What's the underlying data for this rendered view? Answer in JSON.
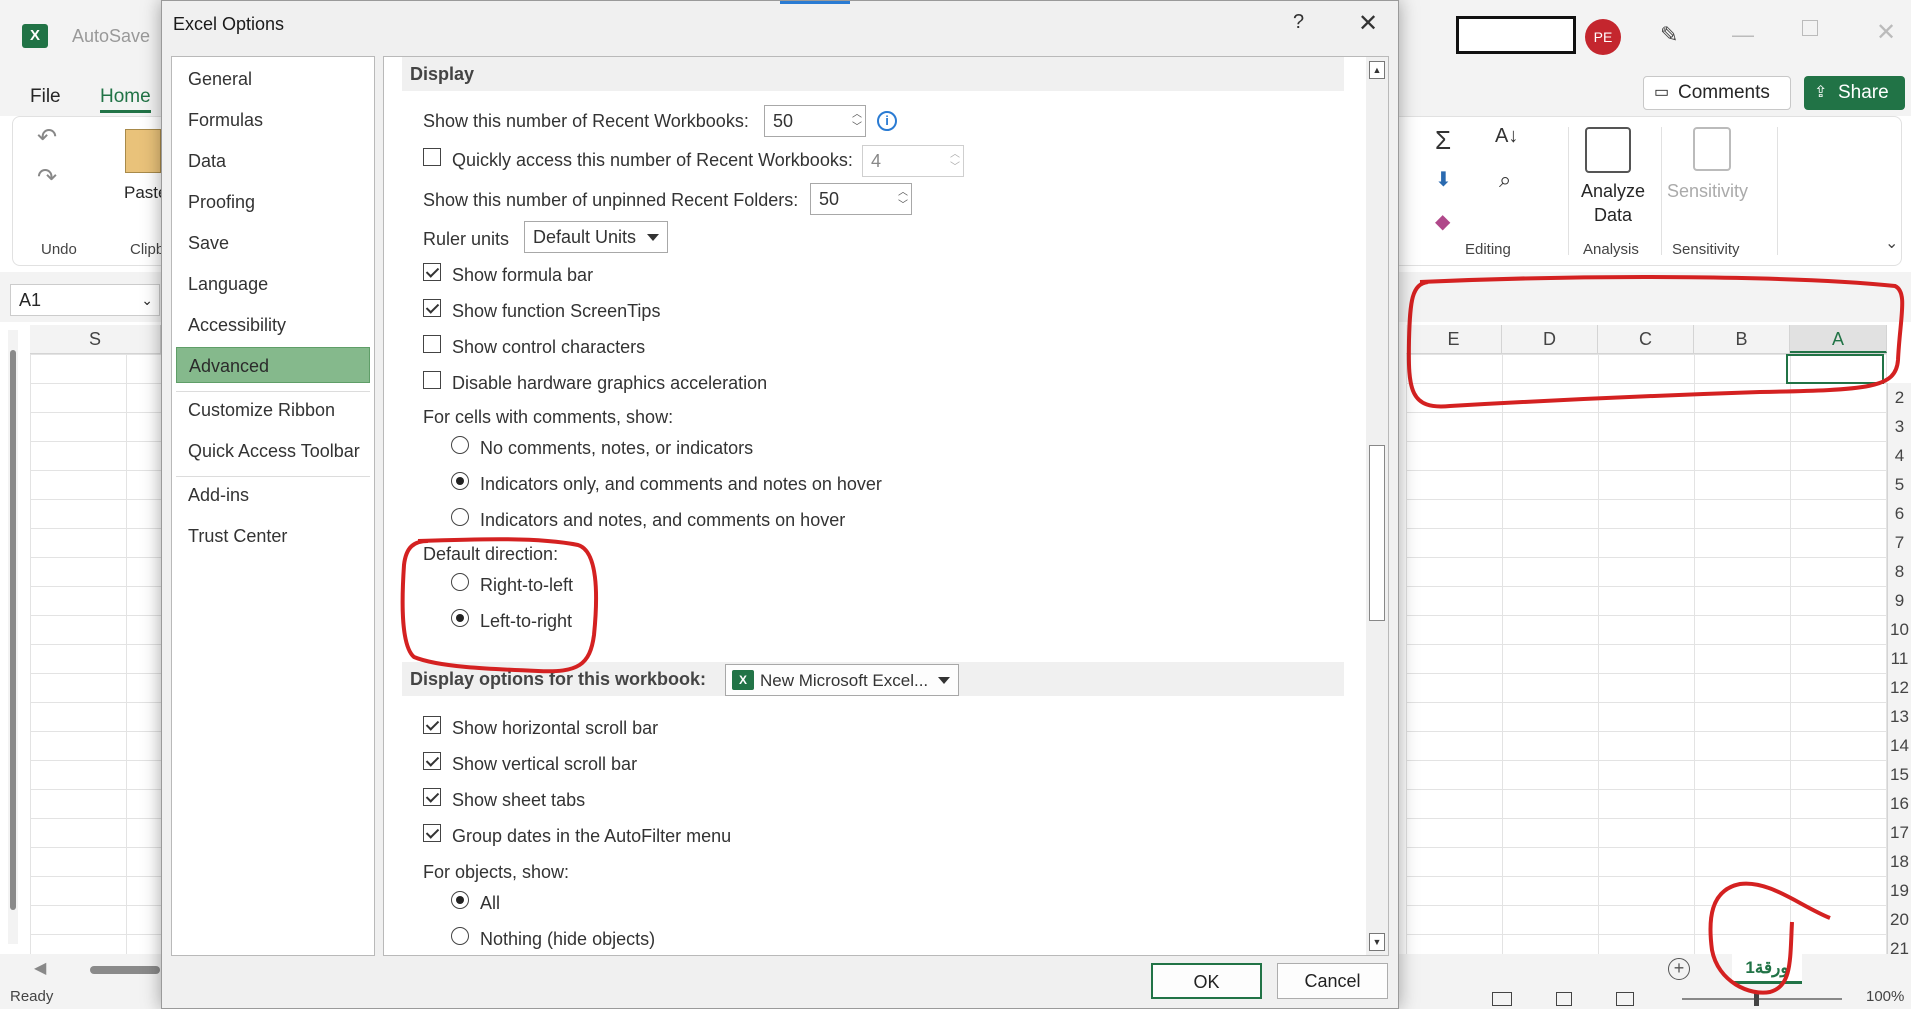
{
  "excel": {
    "autosave_label": "AutoSave",
    "tabs": [
      "File",
      "Home"
    ],
    "avatar_initials": "PE",
    "comments_label": "Comments",
    "share_label": "Share",
    "ribbon": {
      "undo_group": "Undo",
      "paste_label": "Paste",
      "clipboard_group": "Clipb",
      "editing_group": "Editing",
      "analyze_label": "Analyze\nData",
      "analysis_group": "Analysis",
      "sensitivity_label": "Sensitivity",
      "sensitivity_group": "Sensitivity"
    },
    "name_box": "A1",
    "left_col": "S",
    "columns": [
      "E",
      "D",
      "C",
      "B",
      "A"
    ],
    "rows": [
      "2",
      "3",
      "4",
      "5",
      "6",
      "7",
      "8",
      "9",
      "10",
      "11",
      "12",
      "13",
      "14",
      "15",
      "16",
      "17",
      "18",
      "19",
      "20",
      "21"
    ],
    "sheet_tab": "ورقة1",
    "status_ready": "Ready",
    "zoom": "100%"
  },
  "dialog": {
    "title": "Excel Options",
    "help": "?",
    "nav": [
      {
        "label": "General",
        "active": false
      },
      {
        "label": "Formulas",
        "active": false
      },
      {
        "label": "Data",
        "active": false
      },
      {
        "label": "Proofing",
        "active": false
      },
      {
        "label": "Save",
        "active": false
      },
      {
        "label": "Language",
        "active": false
      },
      {
        "label": "Accessibility",
        "active": false
      },
      {
        "label": "Advanced",
        "active": true
      },
      {
        "label": "Customize Ribbon",
        "active": false
      },
      {
        "label": "Quick Access Toolbar",
        "active": false
      },
      {
        "label": "Add-ins",
        "active": false
      },
      {
        "label": "Trust Center",
        "active": false
      }
    ],
    "display": {
      "header": "Display",
      "recent_workbooks_label": "Show this number of Recent Workbooks:",
      "recent_workbooks_value": "50",
      "quick_access_label": "Quickly access this number of Recent Workbooks:",
      "quick_access_value": "4",
      "quick_access_checked": false,
      "recent_folders_label": "Show this number of unpinned Recent Folders:",
      "recent_folders_value": "50",
      "ruler_label": "Ruler units",
      "ruler_value": "Default Units",
      "checks": [
        {
          "label": "Show formula bar",
          "checked": true
        },
        {
          "label": "Show function ScreenTips",
          "checked": true
        },
        {
          "label": "Show control characters",
          "checked": false
        },
        {
          "label": "Disable hardware graphics acceleration",
          "checked": false
        }
      ],
      "comments_label": "For cells with comments, show:",
      "comments_options": [
        {
          "label": "No comments, notes, or indicators",
          "selected": false
        },
        {
          "label": "Indicators only, and comments and notes on hover",
          "selected": true
        },
        {
          "label": "Indicators and notes, and comments on hover",
          "selected": false
        }
      ],
      "direction_label": "Default direction:",
      "direction_options": [
        {
          "label": "Right-to-left",
          "selected": false
        },
        {
          "label": "Left-to-right",
          "selected": true
        }
      ]
    },
    "workbook": {
      "header": "Display options for this workbook:",
      "workbook_value": "New Microsoft Excel...",
      "checks": [
        {
          "label": "Show horizontal scroll bar",
          "checked": true
        },
        {
          "label": "Show vertical scroll bar",
          "checked": true
        },
        {
          "label": "Show sheet tabs",
          "checked": true
        },
        {
          "label": "Group dates in the AutoFilter menu",
          "checked": true
        }
      ],
      "objects_label": "For objects, show:",
      "objects_options": [
        {
          "label": "All",
          "selected": true
        },
        {
          "label": "Nothing (hide objects)",
          "selected": false
        }
      ]
    },
    "ok_label": "OK",
    "cancel_label": "Cancel"
  },
  "colors": {
    "excel_green": "#217346",
    "active_nav": "#85b98c",
    "annotation_red": "#d42121",
    "avatar_red": "#c4262e"
  }
}
